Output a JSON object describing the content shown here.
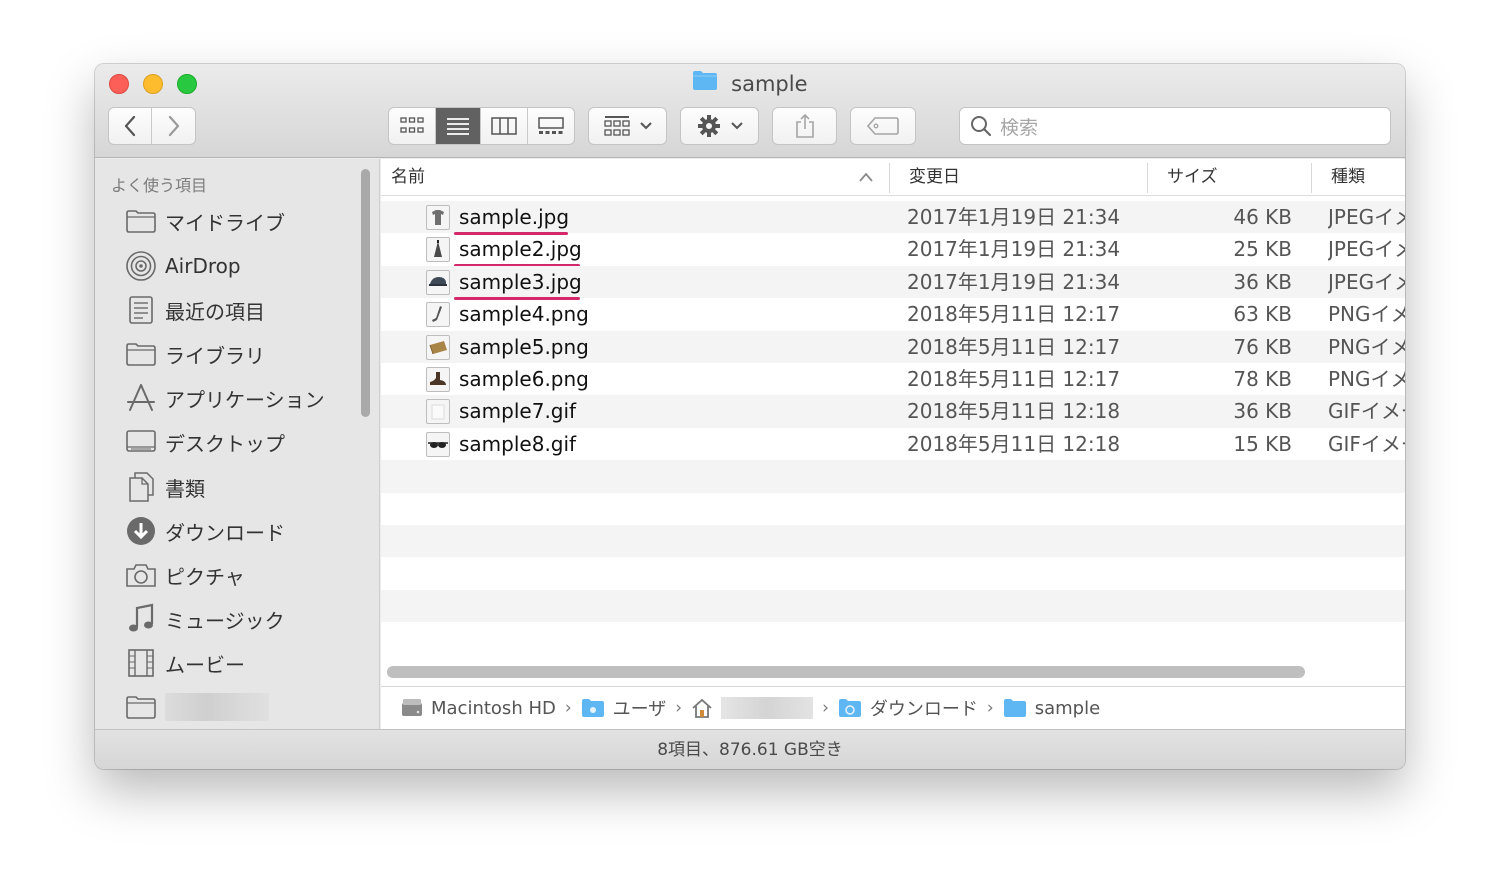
{
  "window": {
    "title": "sample"
  },
  "toolbar": {
    "back_label": "<",
    "forward_label": ">",
    "search_placeholder": "検索"
  },
  "sidebar": {
    "heading": "よく使う項目",
    "items": [
      {
        "label": "マイドライブ",
        "icon": "folder-icon"
      },
      {
        "label": "AirDrop",
        "icon": "airdrop-icon"
      },
      {
        "label": "最近の項目",
        "icon": "recents-icon"
      },
      {
        "label": "ライブラリ",
        "icon": "folder-icon"
      },
      {
        "label": "アプリケーション",
        "icon": "applications-icon"
      },
      {
        "label": "デスクトップ",
        "icon": "desktop-icon"
      },
      {
        "label": "書類",
        "icon": "documents-icon"
      },
      {
        "label": "ダウンロード",
        "icon": "downloads-icon"
      },
      {
        "label": "ピクチャ",
        "icon": "camera-icon"
      },
      {
        "label": "ミュージック",
        "icon": "music-note-icon"
      },
      {
        "label": "ムービー",
        "icon": "film-icon"
      }
    ]
  },
  "columns": {
    "name": "名前",
    "modified": "変更日",
    "size": "サイズ",
    "kind": "種類"
  },
  "files": [
    {
      "name": "sample.jpg",
      "date": "2017年1月19日 21:34",
      "size": "46 KB",
      "kind": "JPEGイメージ"
    },
    {
      "name": "sample2.jpg",
      "date": "2017年1月19日 21:34",
      "size": "25 KB",
      "kind": "JPEGイメージ"
    },
    {
      "name": "sample3.jpg",
      "date": "2017年1月19日 21:34",
      "size": "36 KB",
      "kind": "JPEGイメージ"
    },
    {
      "name": "sample4.png",
      "date": "2018年5月11日 12:17",
      "size": "63 KB",
      "kind": "PNGイメージ"
    },
    {
      "name": "sample5.png",
      "date": "2018年5月11日 12:17",
      "size": "76 KB",
      "kind": "PNGイメージ"
    },
    {
      "name": "sample6.png",
      "date": "2018年5月11日 12:17",
      "size": "78 KB",
      "kind": "PNGイメージ"
    },
    {
      "name": "sample7.gif",
      "date": "2018年5月11日 12:18",
      "size": "36 KB",
      "kind": "GIFイメージ"
    },
    {
      "name": "sample8.gif",
      "date": "2018年5月11日 12:18",
      "size": "15 KB",
      "kind": "GIFイメージ"
    }
  ],
  "pathbar": {
    "crumbs": [
      "Macintosh HD",
      "ユーザ",
      "ダウンロード",
      "sample"
    ],
    "separator": "›"
  },
  "status": {
    "text": "8項目、876.61 GB空き"
  },
  "colors": {
    "highlight_underline": "#d4286a",
    "folder_blue": "#5eb6f2",
    "active_view": "#616161"
  }
}
